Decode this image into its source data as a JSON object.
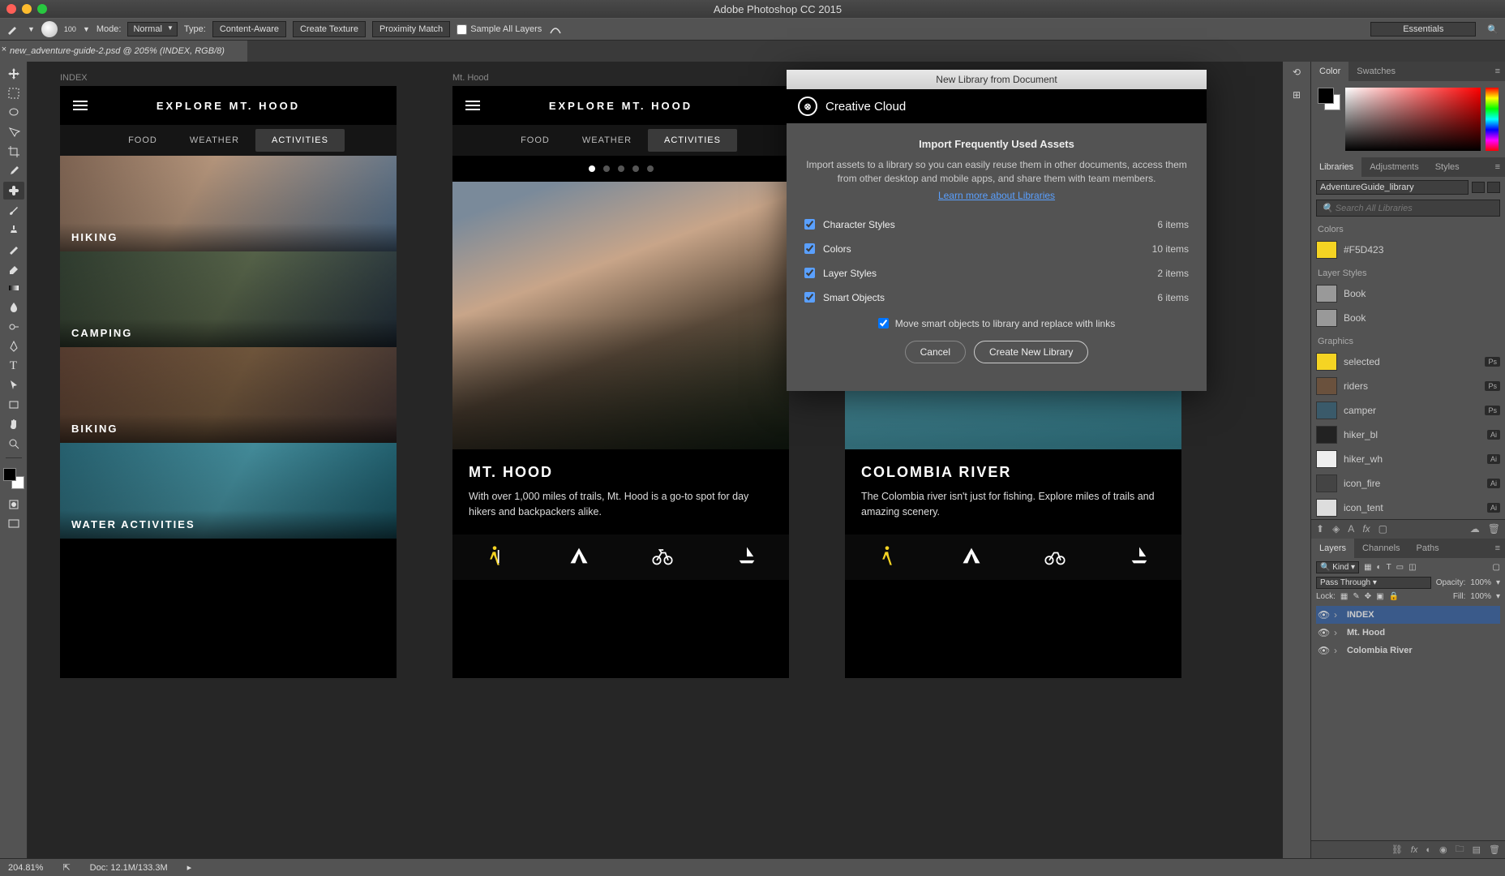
{
  "titlebar": {
    "app_title": "Adobe Photoshop CC 2015"
  },
  "optionsbar": {
    "brush_size": "100",
    "mode_label": "Mode:",
    "mode_value": "Normal",
    "type_label": "Type:",
    "type_btns": [
      "Content-Aware",
      "Create Texture",
      "Proximity Match"
    ],
    "sample_all": "Sample All Layers",
    "workspace": "Essentials"
  },
  "document_tab": "new_adventure-guide-2.psd @ 205% (INDEX, RGB/8)",
  "canvas": {
    "artboard1": {
      "label": "INDEX",
      "title": "EXPLORE MT. HOOD",
      "tabs": [
        "FOOD",
        "WEATHER",
        "ACTIVITIES"
      ],
      "items": [
        "HIKING",
        "CAMPING",
        "BIKING",
        "WATER ACTIVITIES"
      ]
    },
    "artboard2": {
      "label": "Mt. Hood",
      "title": "EXPLORE MT. HOOD",
      "tabs": [
        "FOOD",
        "WEATHER",
        "ACTIVITIES"
      ],
      "heading": "MT. HOOD",
      "body": "With over 1,000 miles of trails, Mt. Hood is a go-to spot for day hikers and backpackers alike."
    },
    "artboard3": {
      "heading": "COLOMBIA RIVER",
      "body": "The Colombia river isn't just for fishing. Explore miles of trails and amazing scenery."
    }
  },
  "dialog": {
    "title": "New Library from Document",
    "cc": "Creative Cloud",
    "heading": "Import Frequently Used Assets",
    "desc": "Import assets to a library so you can easily reuse them in other documents, access them from other desktop and mobile apps, and share them with team members.",
    "learn": "Learn more about Libraries",
    "items": [
      {
        "label": "Character Styles",
        "count": "6 items"
      },
      {
        "label": "Colors",
        "count": "10 items"
      },
      {
        "label": "Layer Styles",
        "count": "2 items"
      },
      {
        "label": "Smart Objects",
        "count": "6 items"
      }
    ],
    "move": "Move smart objects to library and replace with links",
    "cancel": "Cancel",
    "create": "Create New Library"
  },
  "panels": {
    "color_tabs": [
      "Color",
      "Swatches"
    ],
    "lib_tabs": [
      "Libraries",
      "Adjustments",
      "Styles"
    ],
    "library_name": "AdventureGuide_library",
    "search_placeholder": "Search All Libraries",
    "groups": {
      "colors_title": "Colors",
      "color_hex": "#F5D423",
      "layerstyles_title": "Layer Styles",
      "books": [
        "Book",
        "Book"
      ],
      "graphics_title": "Graphics",
      "graphics": [
        {
          "name": "selected",
          "badge": "Ps",
          "color": "#f5d423"
        },
        {
          "name": "riders",
          "badge": "Ps",
          "color": "#6a513d"
        },
        {
          "name": "camper",
          "badge": "Ps",
          "color": "#3a5a6a"
        },
        {
          "name": "hiker_bl",
          "badge": "Ai",
          "color": "#222"
        },
        {
          "name": "hiker_wh",
          "badge": "Ai",
          "color": "#eee"
        },
        {
          "name": "icon_fire",
          "badge": "Ai",
          "color": "#444"
        },
        {
          "name": "icon_tent",
          "badge": "Ai",
          "color": "#ddd"
        }
      ]
    },
    "layers_tabs": [
      "Layers",
      "Channels",
      "Paths"
    ],
    "layers": {
      "kind": "Kind",
      "blend": "Pass Through",
      "opacity_label": "Opacity:",
      "opacity": "100%",
      "lock_label": "Lock:",
      "fill_label": "Fill:",
      "fill": "100%",
      "rows": [
        {
          "name": "INDEX",
          "sel": true
        },
        {
          "name": "Mt. Hood",
          "sel": false
        },
        {
          "name": "Colombia River",
          "sel": false
        }
      ]
    }
  },
  "statusbar": {
    "zoom": "204.81%",
    "doc": "Doc: 12.1M/133.3M"
  }
}
